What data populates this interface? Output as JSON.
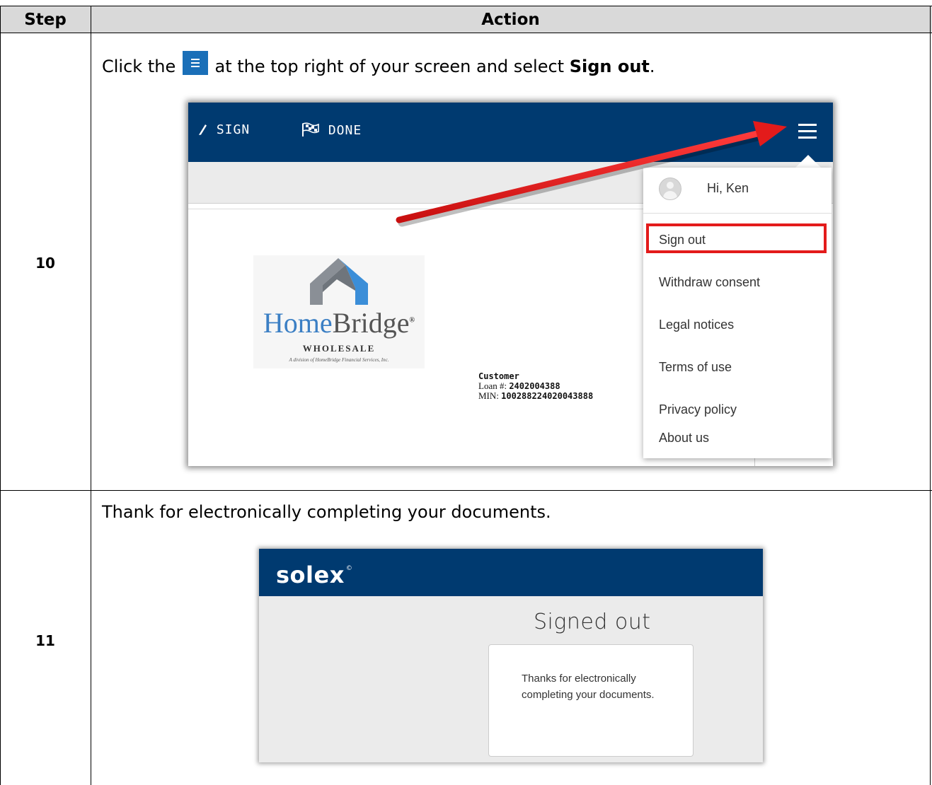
{
  "table": {
    "headers": {
      "step": "Step",
      "action": "Action"
    },
    "rows": [
      {
        "step": "10",
        "instruction": {
          "before": "Click the",
          "after": "at the top right of your screen and select",
          "bold": "Sign out",
          "end": "."
        },
        "screenshot": {
          "toolbar": {
            "sign": "SIGN",
            "done": "DONE"
          },
          "menu": {
            "greeting": "Hi, Ken",
            "items": [
              "Sign out",
              "Withdraw consent",
              "Legal notices",
              "Terms of use",
              "Privacy policy",
              "About us"
            ]
          },
          "logo": {
            "home": "Home",
            "bridge": "Bridge",
            "reg": "®",
            "sub": "WHOLESALE",
            "division": "A division of HomeBridge Financial Services, Inc."
          },
          "customer": {
            "label": "Customer",
            "loan_label": "Loan #:",
            "loan_value": "2402004388",
            "min_label": "MIN:",
            "min_value": "100288224020043888"
          }
        }
      },
      {
        "step": "11",
        "instruction": {
          "text": "Thank for electronically completing your documents."
        },
        "screenshot": {
          "brand": "solex",
          "brand_mark": "©",
          "title": "Signed out",
          "message": "Thanks for electronically completing your documents."
        }
      }
    ]
  },
  "colors": {
    "header_bg": "#d9d9d9",
    "app_bar": "#003a70",
    "highlight": "#e31b1b",
    "arrow": "#e31b1b",
    "menu_button": "#1a6fb8"
  }
}
